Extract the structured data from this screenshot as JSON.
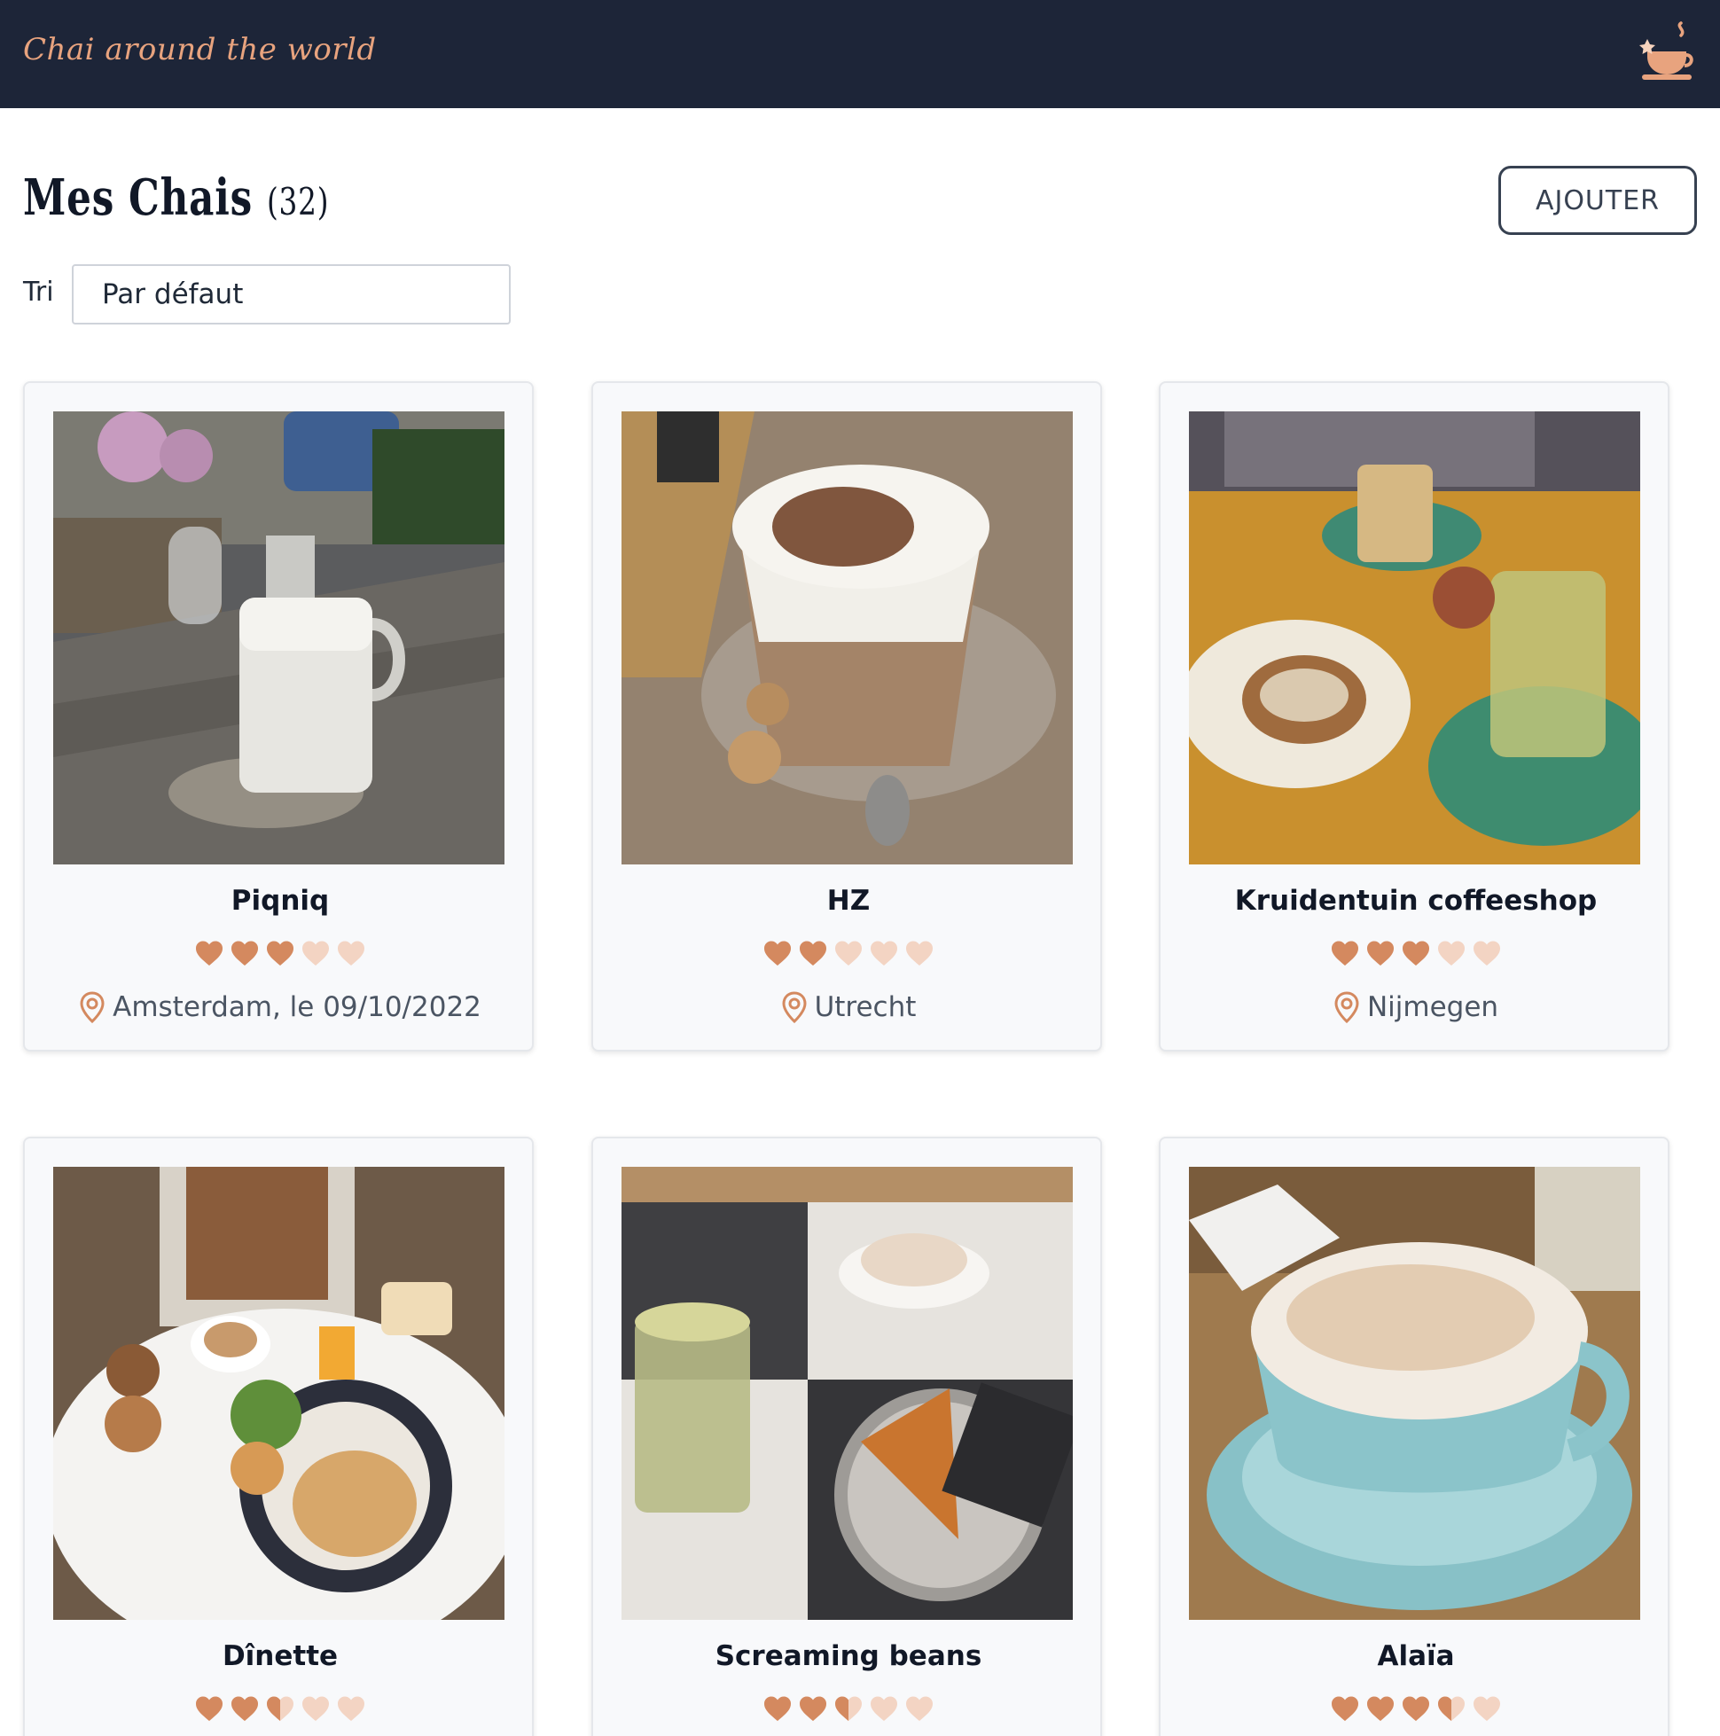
{
  "navbar": {
    "brand": "Chai around the world",
    "logo_icon": "chai-cup-icon"
  },
  "page": {
    "title": "Mes Chais",
    "count": "(32)",
    "add_label": "AJOUTER"
  },
  "sort": {
    "label": "Tri",
    "value": "Par défaut"
  },
  "colors": {
    "navbar_bg": "#1d2538",
    "brand": "#e8a37e",
    "heart_full": "#d4895f",
    "heart_empty": "#f3d4c3",
    "pin": "#d4895f"
  },
  "cards": [
    {
      "name": "Piqniq",
      "rating": 3,
      "location": "Amsterdam, le 09/10/2022"
    },
    {
      "name": "HZ",
      "rating": 2,
      "location": "Utrecht"
    },
    {
      "name": "Kruidentuin coffeeshop",
      "rating": 3,
      "location": "Nijmegen"
    },
    {
      "name": "Dînette",
      "rating": 2.5,
      "location": ""
    },
    {
      "name": "Screaming beans",
      "rating": 2.5,
      "location": ""
    },
    {
      "name": "Alaïa",
      "rating": 3.5,
      "location": ""
    }
  ]
}
